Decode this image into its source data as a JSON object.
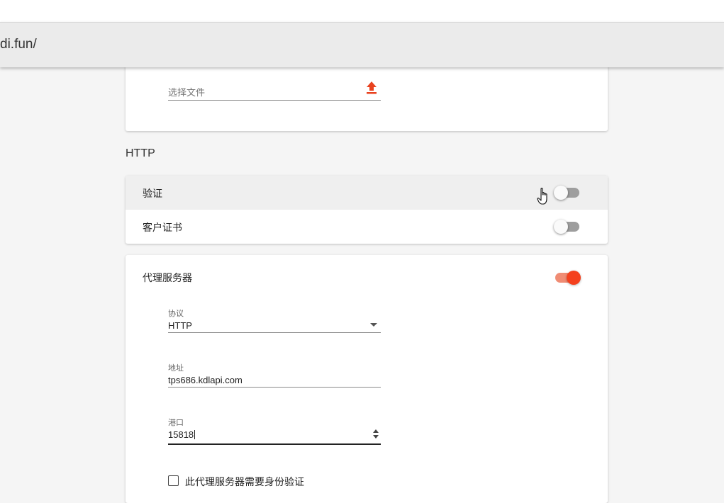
{
  "browser": {
    "url_text": "di.fun/"
  },
  "file_card": {
    "placeholder": "选择文件",
    "upload_icon": "upload-icon"
  },
  "section": {
    "title": "HTTP"
  },
  "auth_card": {
    "verify": {
      "label": "验证",
      "enabled": false
    },
    "client_cert": {
      "label": "客户证书",
      "enabled": false
    }
  },
  "proxy_card": {
    "label": "代理服务器",
    "enabled": true,
    "protocol": {
      "label": "协议",
      "value": "HTTP"
    },
    "address": {
      "label": "地址",
      "value": "tps686.kdlapi.com"
    },
    "port": {
      "label": "港口",
      "value": "15818"
    },
    "requires_auth": {
      "label": "此代理服务器需要身份验证",
      "checked": false
    }
  },
  "colors": {
    "accent": "#f4401d",
    "accent_track": "#f08c74",
    "toggle_off_track": "#9e9e9e",
    "background": "#f5f5f5"
  }
}
